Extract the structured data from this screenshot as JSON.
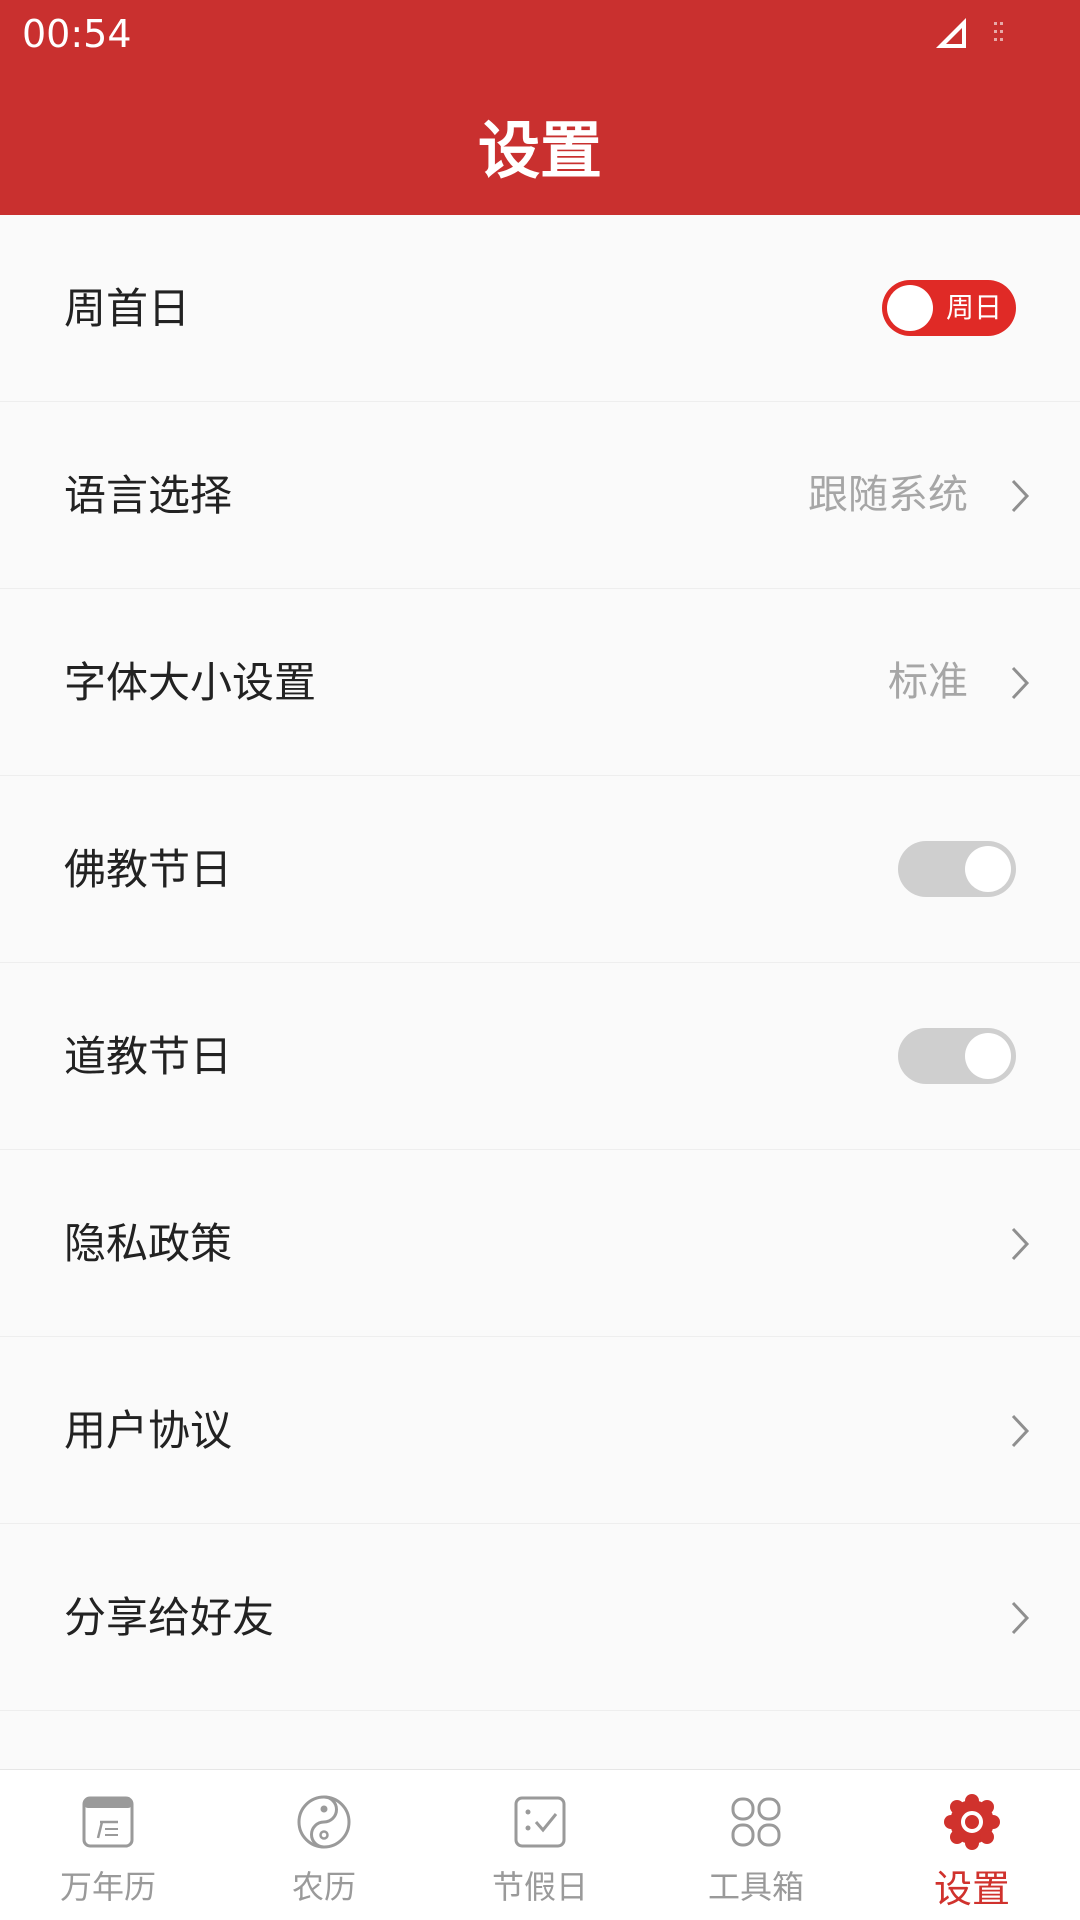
{
  "status_bar": {
    "time": "00:54"
  },
  "header": {
    "title": "设置"
  },
  "settings": [
    {
      "label": "周首日",
      "control": "toggle",
      "state": "on",
      "toggle_text": "周日"
    },
    {
      "label": "语言选择",
      "control": "link",
      "value": "跟随系统"
    },
    {
      "label": "字体大小设置",
      "control": "link",
      "value": "标准"
    },
    {
      "label": "佛教节日",
      "control": "toggle",
      "state": "off"
    },
    {
      "label": "道教节日",
      "control": "toggle",
      "state": "off"
    },
    {
      "label": "隐私政策",
      "control": "link"
    },
    {
      "label": "用户协议",
      "control": "link"
    },
    {
      "label": "分享给好友",
      "control": "link"
    }
  ],
  "bottom_nav": {
    "items": [
      {
        "label": "万年历",
        "icon": "calendar-icon",
        "active": false
      },
      {
        "label": "农历",
        "icon": "yin-yang-icon",
        "active": false
      },
      {
        "label": "节假日",
        "icon": "holiday-check-icon",
        "active": false
      },
      {
        "label": "工具箱",
        "icon": "toolbox-grid-icon",
        "active": false
      },
      {
        "label": "设置",
        "icon": "settings-gear-icon",
        "active": true
      }
    ]
  },
  "colors": {
    "brand_red": "#c9302f",
    "active_red": "#d0322d",
    "toggle_on": "#e02a26",
    "toggle_off": "#cfcfcf",
    "inactive_gray": "#9a9a9a"
  }
}
